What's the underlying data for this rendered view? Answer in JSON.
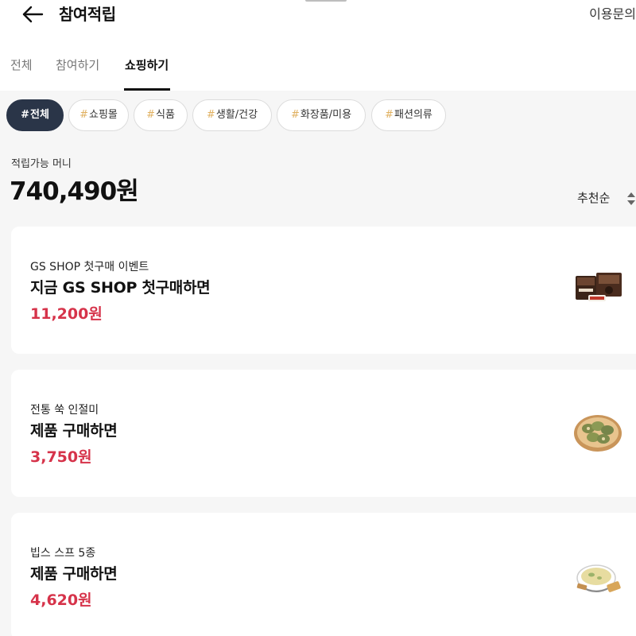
{
  "header": {
    "title": "참여적립",
    "help_label": "이용문의"
  },
  "tabs": [
    {
      "label": "전체",
      "active": false
    },
    {
      "label": "참여하기",
      "active": false
    },
    {
      "label": "쇼핑하기",
      "active": true
    }
  ],
  "categories": [
    {
      "label": "전체",
      "active": true
    },
    {
      "label": "쇼핑몰",
      "active": false
    },
    {
      "label": "식품",
      "active": false
    },
    {
      "label": "생활/건강",
      "active": false
    },
    {
      "label": "화장품/미용",
      "active": false
    },
    {
      "label": "패션의류",
      "active": false
    }
  ],
  "category_prefix": "#",
  "balance": {
    "label": "적립가능 머니",
    "amount": "740,490원"
  },
  "sort": {
    "selected": "추천순"
  },
  "offers": [
    {
      "subtitle": "GS SHOP 첫구매 이벤트",
      "title": "지금 GS SHOP 첫구매하면",
      "reward": "11,200원",
      "image_icon": "brownie-box-image"
    },
    {
      "subtitle": "전통 쑥 인절미",
      "title": "제품 구매하면",
      "reward": "3,750원",
      "image_icon": "rice-cake-image"
    },
    {
      "subtitle": "빕스 스프 5종",
      "title": "제품 구매하면",
      "reward": "4,620원",
      "image_icon": "soup-bowl-image"
    }
  ],
  "colors": {
    "accent_price": "#d6334a",
    "chip_active_bg": "#2a3548",
    "background": "#f6f6f6"
  }
}
